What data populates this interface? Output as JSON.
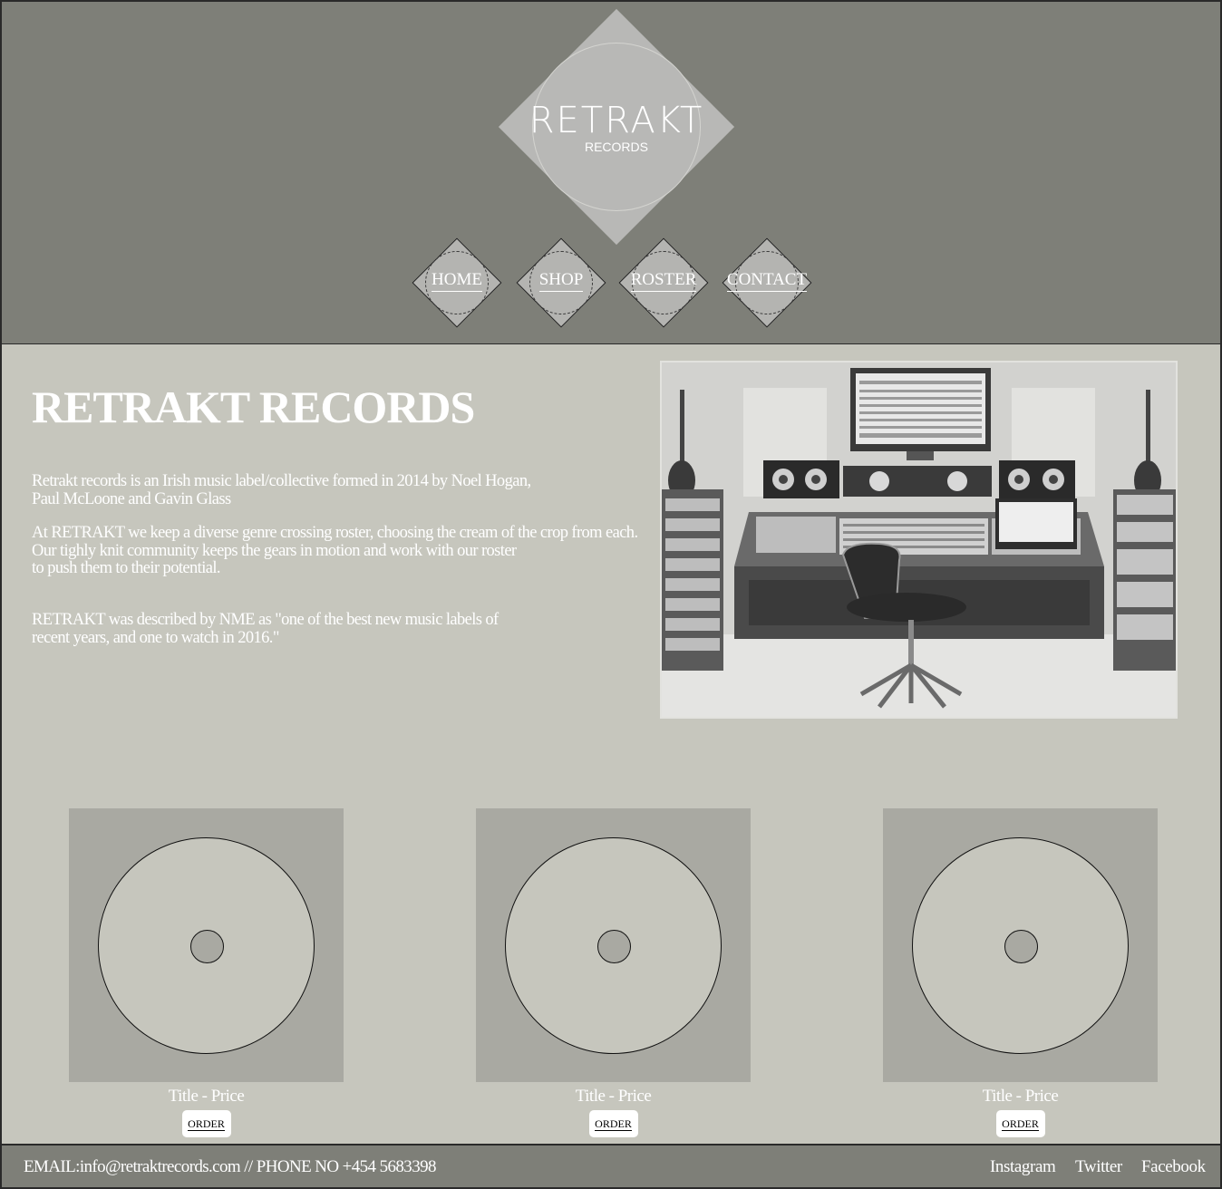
{
  "logo": {
    "wordmark": "RETRAKT",
    "subtitle": "RECORDS"
  },
  "nav": [
    {
      "label": "HOME"
    },
    {
      "label": "SHOP"
    },
    {
      "label": "ROSTER"
    },
    {
      "label": "CONTACT"
    }
  ],
  "intro": {
    "title": "RETRAKT RECORDS",
    "para1": "Retrakt records is an Irish music label/collective formed in 2014 by Noel Hogan,\nPaul McLoone and Gavin Glass",
    "para2": "At RETRAKT we keep a diverse genre crossing roster, choosing the cream of the crop from each.\nOur tighly knit community keeps the gears in motion and work with our roster\n to push them to their potential.",
    "para3": "RETRAKT was described by NME as \"one of the best new music labels of\nrecent years, and one to watch in 2016.\""
  },
  "releases": [
    {
      "label": "Title - Price",
      "button": "ORDER"
    },
    {
      "label": "Title - Price",
      "button": "ORDER"
    },
    {
      "label": "Title - Price",
      "button": "ORDER"
    }
  ],
  "footer": {
    "contact": "EMAIL:info@retraktrecords.com // PHONE NO +454 5683398",
    "social": [
      "Instagram",
      "Twitter",
      "Facebook"
    ]
  },
  "colors": {
    "header_bg": "#7e7f78",
    "main_bg": "#c6c6bd",
    "cover_bg": "#a9a9a2",
    "text": "#ffffff"
  }
}
